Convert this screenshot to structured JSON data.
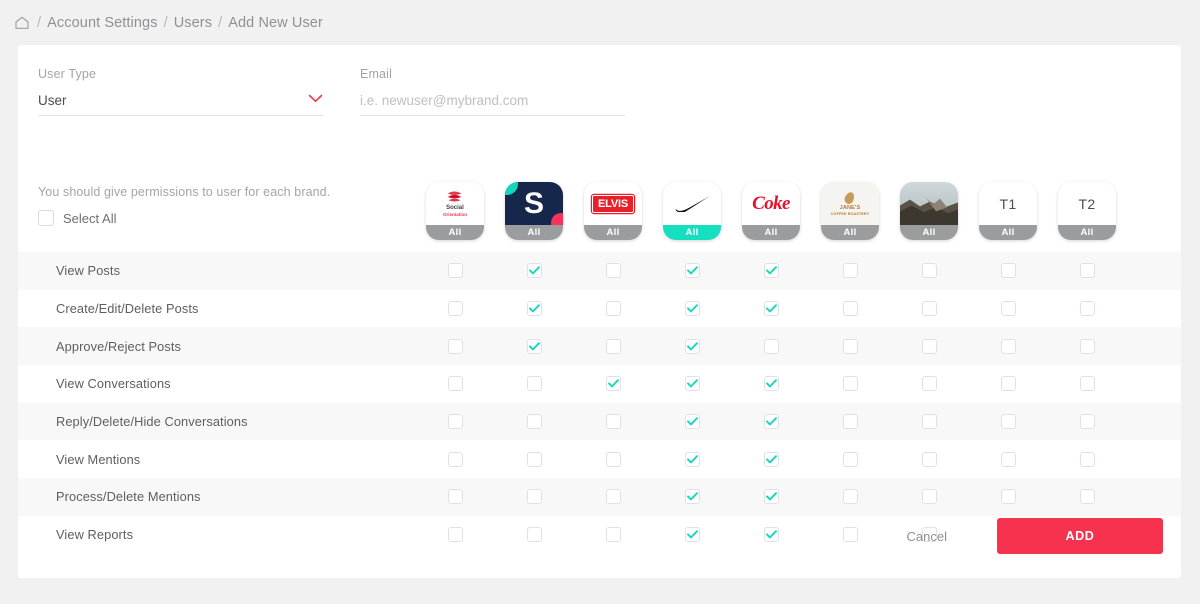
{
  "breadcrumb": {
    "home_icon": "home-icon",
    "separator": "/",
    "items": [
      "Account Settings",
      "Users",
      "Add New User"
    ]
  },
  "form": {
    "user_type": {
      "label": "User Type",
      "value": "User",
      "chevron_icon": "chevron-down-icon",
      "chevron_color": "#f6324f"
    },
    "email": {
      "label": "Email",
      "value": "",
      "placeholder": "i.e. newuser@mybrand.com"
    }
  },
  "permissions": {
    "hint": "You should give permissions to user for each brand.",
    "select_all_label": "Select All",
    "select_all_checked": false
  },
  "brands": [
    {
      "name": "Social Orientation",
      "all_label": "All",
      "all_active": false,
      "logo": "social-orientation-logo",
      "line1": "Social",
      "line2": "Orientation"
    },
    {
      "name": "S Brand",
      "all_label": "All",
      "all_active": false,
      "logo": "s-brand-logo",
      "letter": "S"
    },
    {
      "name": "Elvis",
      "all_label": "All",
      "all_active": false,
      "logo": "elvis-logo",
      "text": "ELVIS"
    },
    {
      "name": "Nike",
      "all_label": "All",
      "all_active": true,
      "logo": "nike-swoosh-logo"
    },
    {
      "name": "Coke",
      "all_label": "All",
      "all_active": false,
      "logo": "coke-logo",
      "text": "Coke"
    },
    {
      "name": "Jane's Coffee Roastery",
      "all_label": "All",
      "all_active": false,
      "logo": "janes-coffee-logo",
      "line1": "JANE'S",
      "line2": "COFFEE ROASTERY"
    },
    {
      "name": "Photo Brand",
      "all_label": "All",
      "all_active": false,
      "logo": "landscape-photo-avatar"
    },
    {
      "name": "T1",
      "all_label": "All",
      "all_active": false,
      "logo": "t1-text-avatar",
      "text": "T1"
    },
    {
      "name": "T2",
      "all_label": "All",
      "all_active": false,
      "logo": "t2-text-avatar",
      "text": "T2"
    }
  ],
  "rows": [
    {
      "label": "View Posts",
      "checks": [
        false,
        true,
        false,
        true,
        true,
        false,
        false,
        false,
        false
      ]
    },
    {
      "label": "Create/Edit/Delete Posts",
      "checks": [
        false,
        true,
        false,
        true,
        true,
        false,
        false,
        false,
        false
      ]
    },
    {
      "label": "Approve/Reject Posts",
      "checks": [
        false,
        true,
        false,
        true,
        false,
        false,
        false,
        false,
        false
      ]
    },
    {
      "label": "View Conversations",
      "checks": [
        false,
        false,
        true,
        true,
        true,
        false,
        false,
        false,
        false
      ]
    },
    {
      "label": "Reply/Delete/Hide Conversations",
      "checks": [
        false,
        false,
        false,
        true,
        true,
        false,
        false,
        false,
        false
      ]
    },
    {
      "label": "View Mentions",
      "checks": [
        false,
        false,
        false,
        true,
        true,
        false,
        false,
        false,
        false
      ]
    },
    {
      "label": "Process/Delete Mentions",
      "checks": [
        false,
        false,
        false,
        true,
        true,
        false,
        false,
        false,
        false
      ]
    },
    {
      "label": "View Reports",
      "checks": [
        false,
        false,
        false,
        true,
        true,
        false,
        false,
        false,
        false
      ]
    }
  ],
  "footer": {
    "cancel_label": "Cancel",
    "add_label": "ADD",
    "add_color": "#f6324f"
  },
  "colors": {
    "accent_red": "#f6324f",
    "check_teal": "#14d8bb",
    "page_bg": "#f1f1f1",
    "row_alt": "#f8f8f9"
  }
}
